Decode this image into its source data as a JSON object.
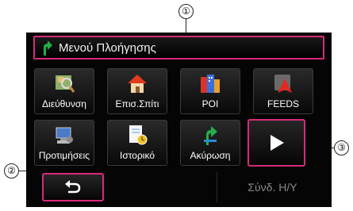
{
  "callouts": {
    "one": "①",
    "two": "②",
    "three": "③"
  },
  "header": {
    "title": "Μενού Πλοήγησης",
    "icon": "navigation-arrow-icon"
  },
  "menu": {
    "row1": [
      {
        "label": "Διεύθυνση",
        "icon": "address-magnifier-icon"
      },
      {
        "label": "Επισ.Σπίτι",
        "icon": "home-icon"
      },
      {
        "label": "POI",
        "icon": "poi-icon"
      },
      {
        "label": "FEEDS",
        "icon": "feeds-icon"
      }
    ],
    "row2": [
      {
        "label": "Προτιμήσεις",
        "icon": "settings-computer-icon"
      },
      {
        "label": "Ιστορικό",
        "icon": "history-clock-icon"
      },
      {
        "label": "Ακύρωση",
        "icon": "cancel-route-icon"
      }
    ]
  },
  "buttons": {
    "next": "play-next-icon",
    "back": "back-arrow-icon",
    "sync_label": "Σύνδ. Η/Υ"
  },
  "colors": {
    "accent": "#d82a7a",
    "background": "#050505"
  }
}
